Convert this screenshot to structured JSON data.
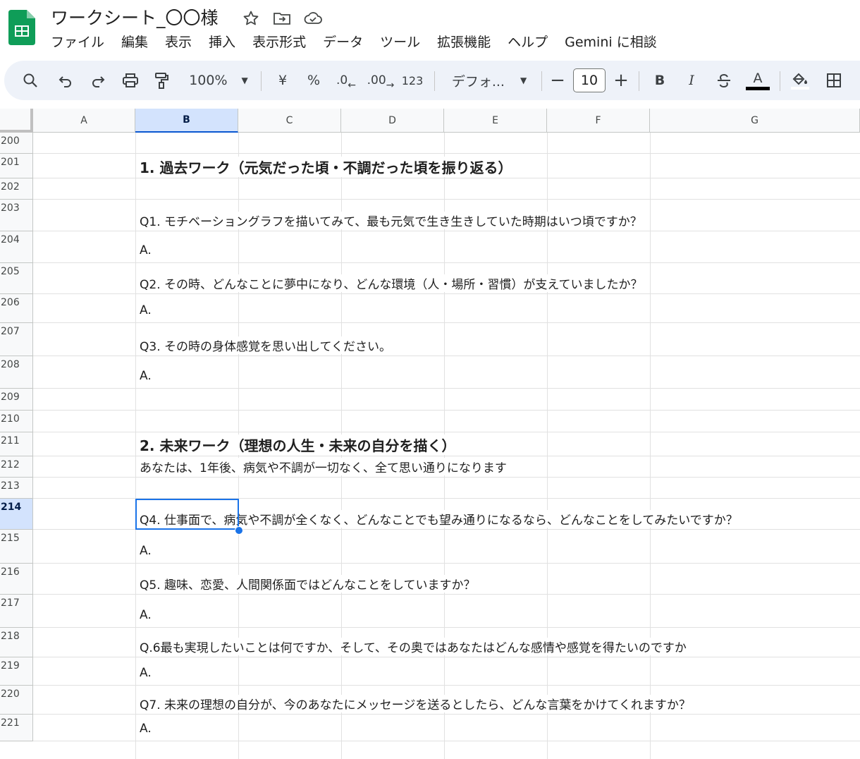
{
  "app": {
    "doc_title": "ワークシート_〇〇様",
    "icons": [
      "star-icon",
      "move-to-folder-icon",
      "cloud-saved-icon"
    ]
  },
  "menu": [
    "ファイル",
    "編集",
    "表示",
    "挿入",
    "表示形式",
    "データ",
    "ツール",
    "拡張機能",
    "ヘルプ",
    "Gemini に相談"
  ],
  "toolbar": {
    "zoom": "100%",
    "currency": "¥",
    "percent": "%",
    "decrease_decimal": ".0",
    "increase_decimal": ".00",
    "number_format": "123",
    "font": "デフォ...",
    "font_size": "10",
    "bold": "B",
    "italic": "I",
    "text_color_letter": "A"
  },
  "columns": [
    "A",
    "B",
    "C",
    "D",
    "E",
    "F",
    "G"
  ],
  "selected_column": "B",
  "selected_row": "214",
  "rows": [
    {
      "n": "200",
      "text": ""
    },
    {
      "n": "201",
      "text": "1. 過去ワーク（元気だった頃・不調だった頃を振り返る）"
    },
    {
      "n": "202",
      "text": ""
    },
    {
      "n": "203",
      "text": "Q1. モチベーショングラフを描いてみて、最も元気で生き生きしていた時期はいつ頃ですか？"
    },
    {
      "n": "204",
      "text": "A."
    },
    {
      "n": "205",
      "text": "Q2. その時、どんなことに夢中になり、どんな環境（人・場所・習慣）が支えていましたか？"
    },
    {
      "n": "206",
      "text": "A."
    },
    {
      "n": "207",
      "text": "Q3. その時の身体感覚を思い出してください。"
    },
    {
      "n": "208",
      "text": "A."
    },
    {
      "n": "209",
      "text": ""
    },
    {
      "n": "210",
      "text": ""
    },
    {
      "n": "211",
      "text": "2. 未来ワーク（理想の人生・未来の自分を描く）"
    },
    {
      "n": "212",
      "text": "あなたは、1年後、病気や不調が一切なく、全て思い通りになります"
    },
    {
      "n": "213",
      "text": ""
    },
    {
      "n": "214",
      "text": "Q4.  仕事面で、病気や不調が全くなく、どんなことでも望み通りになるなら、どんなことをしてみたいですか？"
    },
    {
      "n": "215",
      "text": "A."
    },
    {
      "n": "216",
      "text": "Q5. 趣味、恋愛、人間関係面ではどんなことをしていますか？"
    },
    {
      "n": "217",
      "text": "A."
    },
    {
      "n": "218",
      "text": "Q.6最も実現したいことは何ですか、そして、その奥ではあなたはどんな感情や感覚を得たいのですか"
    },
    {
      "n": "219",
      "text": "A."
    },
    {
      "n": "220",
      "text": "Q7.  未来の理想の自分が、今のあなたにメッセージを送るとしたら、どんな言葉をかけてくれますか？"
    },
    {
      "n": "221",
      "text": "A."
    }
  ]
}
